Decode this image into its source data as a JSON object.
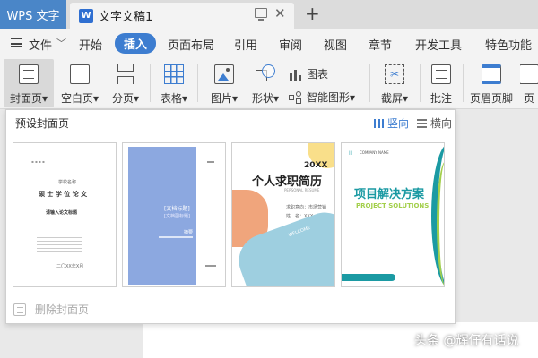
{
  "titlebar": {
    "app_tab": "WPS 文字",
    "doc_icon": "W",
    "doc_title": "文字文稿1",
    "close": "✕",
    "new_tab": "+"
  },
  "menubar": {
    "file": "文件",
    "items": [
      "开始",
      "插入",
      "页面布局",
      "引用",
      "审阅",
      "视图",
      "章节",
      "开发工具",
      "特色功能"
    ],
    "active": "插入"
  },
  "ribbon": {
    "cover": "封面页",
    "blank": "空白页",
    "pagebreak": "分页",
    "table": "表格",
    "picture": "图片",
    "shape": "形状",
    "chart": "图表",
    "smartart": "智能图形",
    "screenshot": "截屏",
    "comment": "批注",
    "header_footer": "页眉页脚",
    "page_number": "页"
  },
  "panel": {
    "title": "预设封面页",
    "vertical": "竖向",
    "horizontal": "横向",
    "delete": "删除封面页"
  },
  "thumbs": {
    "t1": {
      "school": "学校名称",
      "title": "硕 士 学 位 论 文",
      "subtitle": "请输入论文标题",
      "date": "二〇XX年X月"
    },
    "t2": {
      "doc_title": "[文档标题]",
      "doc_subtitle": "[文档副标题]",
      "abstract": "摘要"
    },
    "t3": {
      "year": "20XX",
      "title": "个人求职简历",
      "subtitle": "PERSONAL RESUME",
      "line1": "求职意向：市场营销",
      "line2": "姓　名：XXX",
      "welcome": "WELCOME"
    },
    "t4": {
      "company": "COMPANY NAME",
      "title": "项目解决方案",
      "subtitle": "PROJECT SOLUTIONS"
    }
  },
  "colors": {
    "accent": "#3d7dd0",
    "app_tab": "#4a86c8",
    "thumb2_blue": "#8ca8e0",
    "thumb3_orange": "#f0a57c",
    "thumb3_yellow": "#f9df8a",
    "thumb3_blue": "#9ecfe0",
    "thumb4_teal": "#1b9aa3",
    "thumb4_green": "#a3cf4b"
  },
  "watermark": "头条 @辉仔有话说"
}
